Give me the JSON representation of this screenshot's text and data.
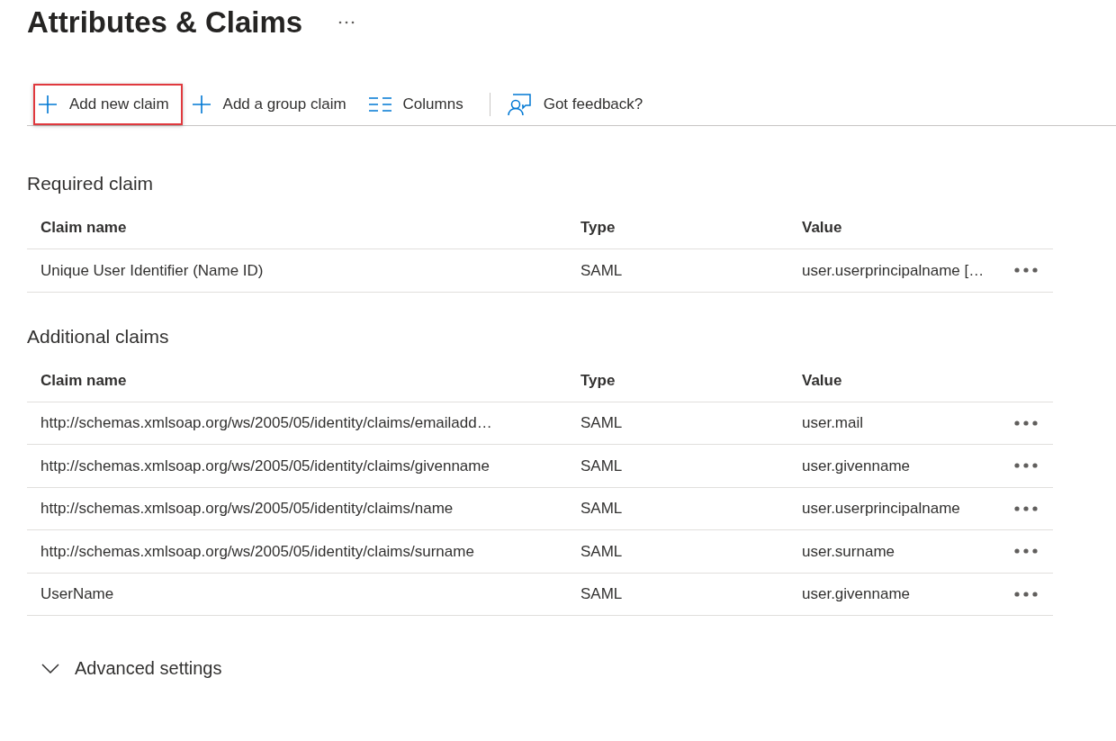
{
  "page": {
    "title": "Attributes & Claims"
  },
  "toolbar": {
    "groups": [
      [
        {
          "kind": "add",
          "label": "Add new claim",
          "highlighted": true
        },
        {
          "kind": "add",
          "label": "Add a group claim",
          "highlighted": false
        },
        {
          "kind": "columns",
          "label": "Columns",
          "highlighted": false
        }
      ],
      [
        {
          "kind": "feedback",
          "label": "Got feedback?",
          "highlighted": false
        }
      ]
    ]
  },
  "sections": [
    {
      "title": "Required claim",
      "columns": [
        "Claim name",
        "Type",
        "Value"
      ],
      "rows": [
        {
          "claim_name": "Unique User Identifier (Name ID)",
          "type": "SAML",
          "value": "user.userprincipalname […"
        }
      ]
    },
    {
      "title": "Additional claims",
      "columns": [
        "Claim name",
        "Type",
        "Value"
      ],
      "rows": [
        {
          "claim_name": "http://schemas.xmlsoap.org/ws/2005/05/identity/claims/emailadd…",
          "type": "SAML",
          "value": "user.mail"
        },
        {
          "claim_name": "http://schemas.xmlsoap.org/ws/2005/05/identity/claims/givenname",
          "type": "SAML",
          "value": "user.givenname"
        },
        {
          "claim_name": "http://schemas.xmlsoap.org/ws/2005/05/identity/claims/name",
          "type": "SAML",
          "value": "user.userprincipalname"
        },
        {
          "claim_name": "http://schemas.xmlsoap.org/ws/2005/05/identity/claims/surname",
          "type": "SAML",
          "value": "user.surname"
        },
        {
          "claim_name": "UserName",
          "type": "SAML",
          "value": "user.givenname"
        }
      ]
    }
  ],
  "advanced_settings": {
    "label": "Advanced settings",
    "expanded": false
  }
}
